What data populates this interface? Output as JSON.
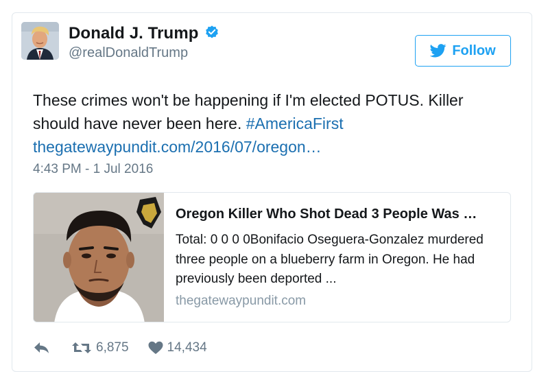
{
  "author": {
    "display_name": "Donald J. Trump",
    "handle": "@realDonaldTrump",
    "verified_icon": "verified-badge-icon"
  },
  "follow_button": {
    "label": "Follow",
    "icon": "twitter-bird-icon"
  },
  "tweet": {
    "text": "These crimes won't be happening if I'm elected POTUS. Killer should have never been here.",
    "hashtag": "#AmericaFirst",
    "link": "thegatewaypundit.com/2016/07/oregon…",
    "timestamp": "4:43 PM - 1 Jul 2016"
  },
  "link_card": {
    "title": "Oregon Killer Who Shot Dead 3 People Was …",
    "description": "Total: 0 0 0 0Bonifacio Oseguera-Gonzalez murdered three people on a blueberry farm in Oregon. He had previously been deported ...",
    "domain": "thegatewaypundit.com",
    "thumbnail": "mugshot-photo"
  },
  "actions": {
    "reply_icon": "reply-icon",
    "retweet_icon": "retweet-icon",
    "retweet_count": "6,875",
    "like_icon": "heart-icon",
    "like_count": "14,434"
  },
  "colors": {
    "accent": "#1da1f2",
    "link": "#1b6fb0",
    "muted": "#657786",
    "border": "#e1e8ed"
  }
}
